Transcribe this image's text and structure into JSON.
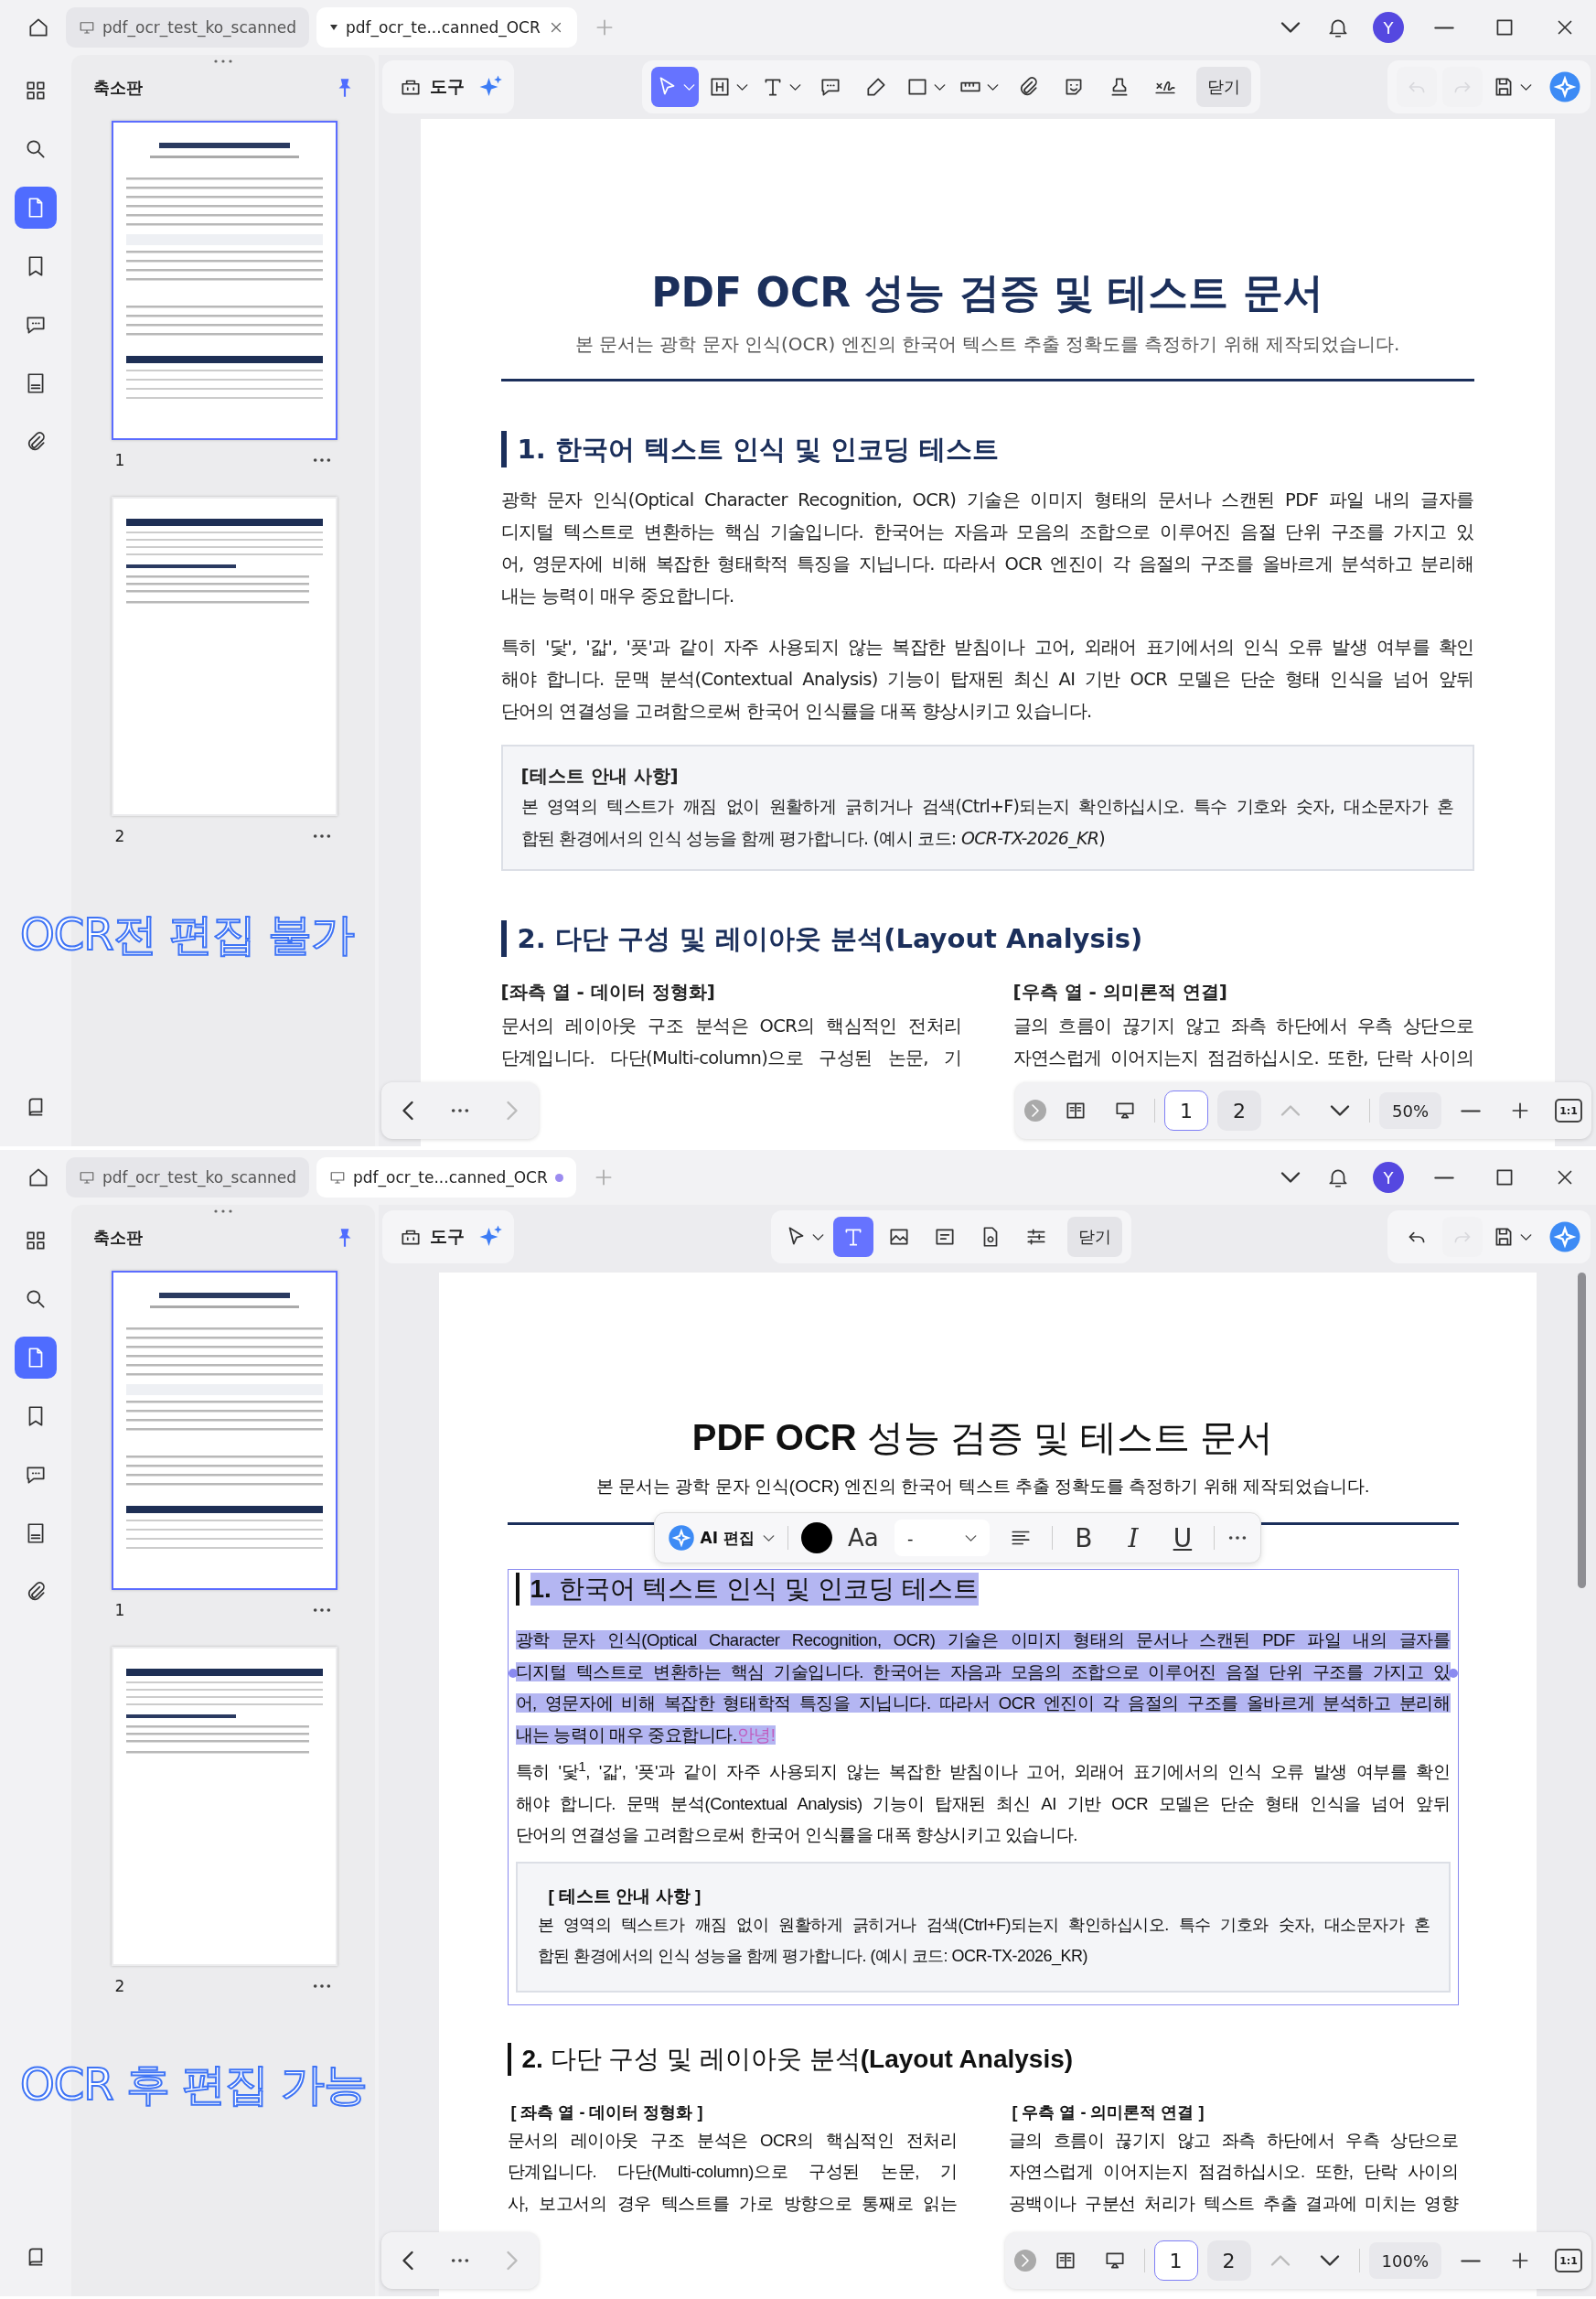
{
  "windows": [
    {
      "tabs": [
        {
          "label": "pdf_ocr_test_ko_scanned",
          "selected": false,
          "closable": false,
          "modified": false
        },
        {
          "label": "pdf_ocr_te...canned_OCR",
          "selected": true,
          "closable": true,
          "modified": false
        }
      ],
      "avatar": "Y",
      "rail": [
        {
          "kind": "grid",
          "selected": false
        },
        {
          "kind": "search",
          "selected": false
        },
        {
          "kind": "page",
          "selected": true
        },
        {
          "kind": "bookmark",
          "selected": false
        },
        {
          "kind": "comment",
          "selected": false
        },
        {
          "kind": "stack",
          "selected": false
        },
        {
          "kind": "clip",
          "selected": false
        }
      ],
      "panel": {
        "title": "축소판",
        "pages": [
          {
            "number": "1",
            "selected": true
          },
          {
            "number": "2",
            "selected": false
          }
        ],
        "overlay": "OCR전 편집 불가"
      },
      "toolbar": {
        "tools_label": "도구",
        "close_label": "닫기",
        "tools": [
          {
            "kind": "cursor",
            "selected": true,
            "caret": true
          },
          {
            "kind": "heading",
            "selected": false,
            "caret": true
          },
          {
            "kind": "text",
            "selected": false,
            "caret": true
          },
          {
            "kind": "comment",
            "selected": false,
            "caret": false
          },
          {
            "kind": "pen",
            "selected": false,
            "caret": false
          },
          {
            "kind": "rect",
            "selected": false,
            "caret": true
          },
          {
            "kind": "ruler",
            "selected": false,
            "caret": true
          },
          {
            "kind": "clip",
            "selected": false,
            "caret": false
          },
          {
            "kind": "sticker",
            "selected": false,
            "caret": false
          },
          {
            "kind": "stamp",
            "selected": false,
            "caret": false
          },
          {
            "kind": "signature",
            "selected": false,
            "caret": false
          }
        ],
        "history": [
          {
            "kind": "undo",
            "disabled": true
          },
          {
            "kind": "redo",
            "disabled": true
          }
        ]
      },
      "doc": {
        "scrollbar": false,
        "title": "PDF OCR 성능 검증 및 테스트 문서",
        "subtitle": "본 문서는 광학 문자 인식(OCR) 엔진의 한국어 텍스트 추출 정확도를 측정하기 위해 제작되었습니다.",
        "sections": [
          {
            "heading": "1. 한국어 텍스트 인식 및 인코딩 테스트",
            "selected": false,
            "paragraphs": [
              {
                "selected": false,
                "lines": [
                  "광학 문자 인식(Optical Character Recognition, OCR) 기술은 이미지 형태의 문서나 스캔된 PDF 파일 내의 글자를",
                  "디지털 텍스트로 변환하는 핵심 기술입니다. 한국어는 자음과 모음의 조합으로 이루어진 음절 단위 구조를 가지고 있",
                  "어, 영문자에 비해 복잡한 형태학적 특징을 지닙니다. 따라서 OCR 엔진이 각 음절의 구조를 올바르게 분석하고 분리해",
                  "내는 능력이 매우 중요합니다."
                ]
              },
              {
                "selected": false,
                "lines": [
                  "특히 '닻', '갋', '픗'과 같이 자주 사용되지 않는 복잡한 받침이나 고어, 외래어 표기에서의 인식 오류 발생 여부를 확인",
                  "해야 합니다. 문맥 분석(Contextual Analysis) 기능이 탑재된 최신 AI 기반 OCR 모델은 단순 형태 인식을 넘어 앞뒤",
                  "단어의 연결성을 고려함으로써 한국어 인식률을 대폭 향상시키고 있습니다."
                ]
              }
            ],
            "note": {
              "heading": "[테스트 안내 사항]",
              "lines": [
                "본 영역의 텍스트가 깨짐 없이 원활하게 긁히거나 검색(Ctrl+F)되는지 확인하십시오. 특수 기호와 숫자, 대소문자가 혼",
                "합된 환경에서의 인식 성능을 함께 평가합니다. (예시 코드: *OCR-TX-2026_KR*)"
              ]
            }
          },
          {
            "heading": "2. 다단 구성 및 레이아웃 분석(Layout Analysis)",
            "selected": false,
            "columns": [
              {
                "heading": "[좌측 열 - 데이터 정형화]",
                "lines": [
                  "문서의 레이아웃 구조 분석은 OCR의 핵심적인 전처리",
                  "단계입니다. 다단(Multi-column)으로 구성된 논문, 기"
                ]
              },
              {
                "heading": "[우측 열 - 의미론적 연결]",
                "lines": [
                  "글의 흐름이 끊기지 않고 좌측 하단에서 우측 상단으로",
                  "자연스럽게 이어지는지 점검하십시오. 또한, 단락 사이의"
                ]
              }
            ]
          }
        ]
      },
      "nav": {
        "pages": [
          {
            "label": "1",
            "selected": true
          },
          {
            "label": "2",
            "selected": false
          }
        ],
        "zoom": "50%",
        "fit": "1:1"
      }
    },
    {
      "tabs": [
        {
          "label": "pdf_ocr_test_ko_scanned",
          "selected": false,
          "closable": false,
          "modified": false
        },
        {
          "label": "pdf_ocr_te...canned_OCR",
          "selected": true,
          "closable": false,
          "modified": true
        }
      ],
      "avatar": "Y",
      "rail": [
        {
          "kind": "grid",
          "selected": false
        },
        {
          "kind": "search",
          "selected": false
        },
        {
          "kind": "page",
          "selected": true
        },
        {
          "kind": "bookmark",
          "selected": false
        },
        {
          "kind": "comment",
          "selected": false
        },
        {
          "kind": "stack",
          "selected": false
        },
        {
          "kind": "clip",
          "selected": false
        }
      ],
      "panel": {
        "title": "축소판",
        "pages": [
          {
            "number": "1",
            "selected": true
          },
          {
            "number": "2",
            "selected": false
          }
        ],
        "overlay": "OCR 후 편집 가능"
      },
      "toolbar": {
        "tools_label": "도구",
        "close_label": "닫기",
        "tools": [
          {
            "kind": "cursor",
            "selected": false,
            "caret": true
          },
          {
            "kind": "text",
            "selected": true,
            "caret": false
          },
          {
            "kind": "image",
            "selected": false,
            "caret": false
          },
          {
            "kind": "linkbox",
            "selected": false,
            "caret": false
          },
          {
            "kind": "badge",
            "selected": false,
            "caret": false
          },
          {
            "kind": "sliders",
            "selected": false,
            "caret": false
          }
        ],
        "history": [
          {
            "kind": "undo",
            "disabled": false
          },
          {
            "kind": "redo",
            "disabled": true
          }
        ]
      },
      "format": {
        "ai_label": "AI 편집",
        "color": "#000000",
        "font_label": "Aa",
        "size": "-",
        "styles": [
          {
            "kind": "bold",
            "label": "B"
          },
          {
            "kind": "italic",
            "label": "I"
          },
          {
            "kind": "underline",
            "label": "U"
          }
        ]
      },
      "doc": {
        "scrollbar": true,
        "title": "**PDF OCR** 성능 검증 및 테스트 문서",
        "subtitle": "본 문서는 광학 문자 인식(OCR) 엔진의 한국어 텍스트 추출 정확도를 측정하기 위해 제작되었습니다.",
        "sections": [
          {
            "heading": "**1.** 한국어 텍스트 인식 및 인코딩 테스트",
            "selected": true,
            "paragraphs": [
              {
                "selected": true,
                "inserted": "안녕!",
                "lines": [
                  "광학 문자 인식(Optical Character Recognition, OCR) 기술은 이미지 형태의 문서나 스캔된 PDF 파일 내의 글자를",
                  "디지털 텍스트로 변환하는 핵심 기술입니다. 한국어는 자음과 모음의 조합으로 이루어진 음절 단위 구조를 가지고 있",
                  "어, 영문자에 비해 복잡한 형태학적 특징을 지닙니다. 따라서 OCR 엔진이 각 음절의 구조를 올바르게 분석하고 분리해",
                  "내는 능력이 매우 중요합니다."
                ]
              },
              {
                "selected": false,
                "lines": [
                  "특히 '닻$^{1}$, '갋', '픗'과 같이 자주 사용되지 않는 복잡한 받침이나 고어, 외래어 표기에서의 인식 오류 발생 여부를 확인",
                  "해야 합니다. 문맥 분석(Contextual Analysis) 기능이 탑재된 최신 AI 기반 OCR 모델은 단순 형태 인식을 넘어 앞뒤",
                  "단어의 연결성을 고려함으로써 한국어 인식률을 대폭 향상시키고 있습니다."
                ]
              }
            ],
            "note": {
              "heading": "[ 테스트 안내 사항 ]",
              "lines": [
                "본 영역의 텍스트가 깨짐 없이 원활하게 긁히거나 검색(Ctrl+F)되는지 확인하십시오. 특수 기호와 숫자, 대소문자가 혼",
                "합된 환경에서의 인식 성능을 함께 평가합니다. (예시 코드: OCR-TX-2026_KR)"
              ]
            }
          },
          {
            "heading": "**2.** 다단 구성 및 레이아웃 분석**(Layout Analysis)**",
            "selected": false,
            "columns": [
              {
                "heading": "[ 좌측 열 - 데이터 정형화 ]",
                "lines": [
                  "문서의 레이아웃 구조 분석은 OCR의 핵심적인 전처리",
                  "단계입니다. 다단(Multi-column)으로 구성된 논문, 기",
                  "사, 보고서의 경우 텍스트를 가로 방향으로 통째로 읽는"
                ]
              },
              {
                "heading": "[ 우측 열 - 의미론적 연결 ]",
                "lines": [
                  "글의 흐름이 끊기지 않고 좌측 하단에서 우측 상단으로",
                  "자연스럽게 이어지는지 점검하십시오. 또한, 단락 사이의",
                  "공백이나 구분선 처리가 텍스트 추출 결과에 미치는 영향"
                ]
              }
            ]
          }
        ]
      },
      "nav": {
        "pages": [
          {
            "label": "1",
            "selected": true
          },
          {
            "label": "2",
            "selected": false
          }
        ],
        "zoom": "100%",
        "fit": "1:1"
      }
    }
  ]
}
